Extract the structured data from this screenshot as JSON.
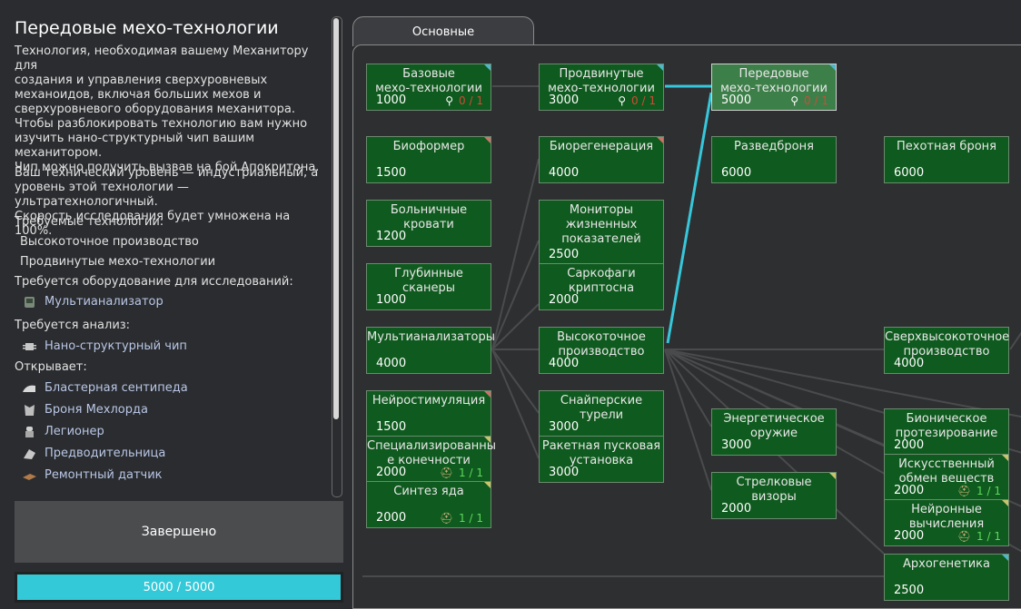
{
  "detail": {
    "title": "Передовые мехо-технологии",
    "description": [
      "Технология, необходимая вашему Механитору для",
      "создания и управления сверхуровневых",
      "механоидов, включая больших мехов и",
      "сверхуровневого оборудования механитора."
    ],
    "unlock_note": [
      "Чтобы разблокировать технологию вам нужно",
      "изучить нано-структурный чип вашим механитором.",
      "Чип можно получить вызвав на бой Апокритона."
    ],
    "tech_level": [
      "Ваш технический уровень — индустриальный, а",
      "уровень этой технологии — ультратехнологичный.",
      "Скорость исследования будет умножена на 100%."
    ],
    "required_label": "Требуемые технологии:",
    "required": [
      "Высокоточное производство",
      "Продвинутые мехо-технологии"
    ],
    "equipment_label": "Требуется оборудование для исследований:",
    "equipment": "Мультианализатор",
    "analysis_label": "Требуется анализ:",
    "analysis": "Нано-структурный чип",
    "unlocks_label": "Открывает:",
    "unlocks": [
      "Бластерная сентипеда",
      "Броня Мехлорда",
      "Легионер",
      "Предводительница",
      "Ремонтный датчик"
    ],
    "done_label": "Завершено",
    "progress": {
      "text": "5000 / 5000",
      "fraction": 1.0
    }
  },
  "tab": "Основные",
  "nodes": [
    {
      "id": "n1",
      "name": [
        "Базовые",
        "мехо-технологии"
      ],
      "cost": "1000",
      "req": "0 / 1",
      "req_type": "analysis",
      "req_color": "red",
      "corner": "blue"
    },
    {
      "id": "n2",
      "name": [
        "Продвинутые",
        "мехо-технологии"
      ],
      "cost": "3000",
      "req": "0 / 1",
      "req_type": "analysis",
      "req_color": "red",
      "corner": "blue"
    },
    {
      "id": "n3",
      "name": [
        "Передовые",
        "мехо-технологии"
      ],
      "cost": "5000",
      "req": "0 / 1",
      "req_type": "analysis",
      "req_color": "red",
      "corner": "blue",
      "selected": true
    },
    {
      "id": "n4",
      "name": [
        "Биоформер"
      ],
      "cost": "1500",
      "corner": "red"
    },
    {
      "id": "n5",
      "name": [
        "Биорегенерация"
      ],
      "cost": "4000",
      "corner": "red"
    },
    {
      "id": "n6",
      "name": [
        "Разведброня"
      ],
      "cost": "6000"
    },
    {
      "id": "n7",
      "name": [
        "Пехотная броня"
      ],
      "cost": "6000"
    },
    {
      "id": "n8",
      "name": [
        "Больничные кровати"
      ],
      "cost": "1200"
    },
    {
      "id": "n9",
      "name": [
        "Мониторы",
        "жизненных",
        "показателей"
      ],
      "cost": "2500"
    },
    {
      "id": "n10",
      "name": [
        "Глубинные сканеры"
      ],
      "cost": "1000"
    },
    {
      "id": "n11",
      "name": [
        "Саркофаги",
        "криптосна"
      ],
      "cost": "2000"
    },
    {
      "id": "n12",
      "name": [
        "Мультианализаторы"
      ],
      "cost": "4000"
    },
    {
      "id": "n13",
      "name": [
        "Высокоточное",
        "производство"
      ],
      "cost": "4000"
    },
    {
      "id": "n14",
      "name": [
        "Сверхвысокоточное",
        "производство"
      ],
      "cost": "4000"
    },
    {
      "id": "n15",
      "name": [
        "Нейростимуляция"
      ],
      "cost": "1500",
      "corner": "red"
    },
    {
      "id": "n16",
      "name": [
        "Снайперские турели"
      ],
      "cost": "3000"
    },
    {
      "id": "n17",
      "name": [
        "Энергетическое",
        "оружие"
      ],
      "cost": "3000"
    },
    {
      "id": "n18",
      "name": [
        "Бионическое",
        "протезирование"
      ],
      "cost": "2000"
    },
    {
      "id": "n19",
      "name": [
        "Специализированны",
        "е конечности"
      ],
      "cost": "2000",
      "req": "1 / 1",
      "req_type": "mech",
      "req_color": "green",
      "corner": "yellow"
    },
    {
      "id": "n20",
      "name": [
        "Ракетная пусковая",
        "установка"
      ],
      "cost": "3000"
    },
    {
      "id": "n21",
      "name": [
        "Стрелковые визоры"
      ],
      "cost": "2000",
      "corner": "yellow"
    },
    {
      "id": "n22",
      "name": [
        "Искусственный",
        "обмен веществ"
      ],
      "cost": "2000",
      "req": "1 / 1",
      "req_type": "mech",
      "req_color": "green",
      "corner": "yellow"
    },
    {
      "id": "n23",
      "name": [
        "Синтез яда"
      ],
      "cost": "2000",
      "req": "1 / 1",
      "req_type": "mech",
      "req_color": "green",
      "corner": "yellow"
    },
    {
      "id": "n24",
      "name": [
        "Нейронные",
        "вычисления"
      ],
      "cost": "2000",
      "req": "1 / 1",
      "req_type": "mech",
      "req_color": "green",
      "corner": "yellow"
    },
    {
      "id": "n25",
      "name": [
        "Архогенетика"
      ],
      "cost": "2500",
      "corner": "blue"
    }
  ]
}
